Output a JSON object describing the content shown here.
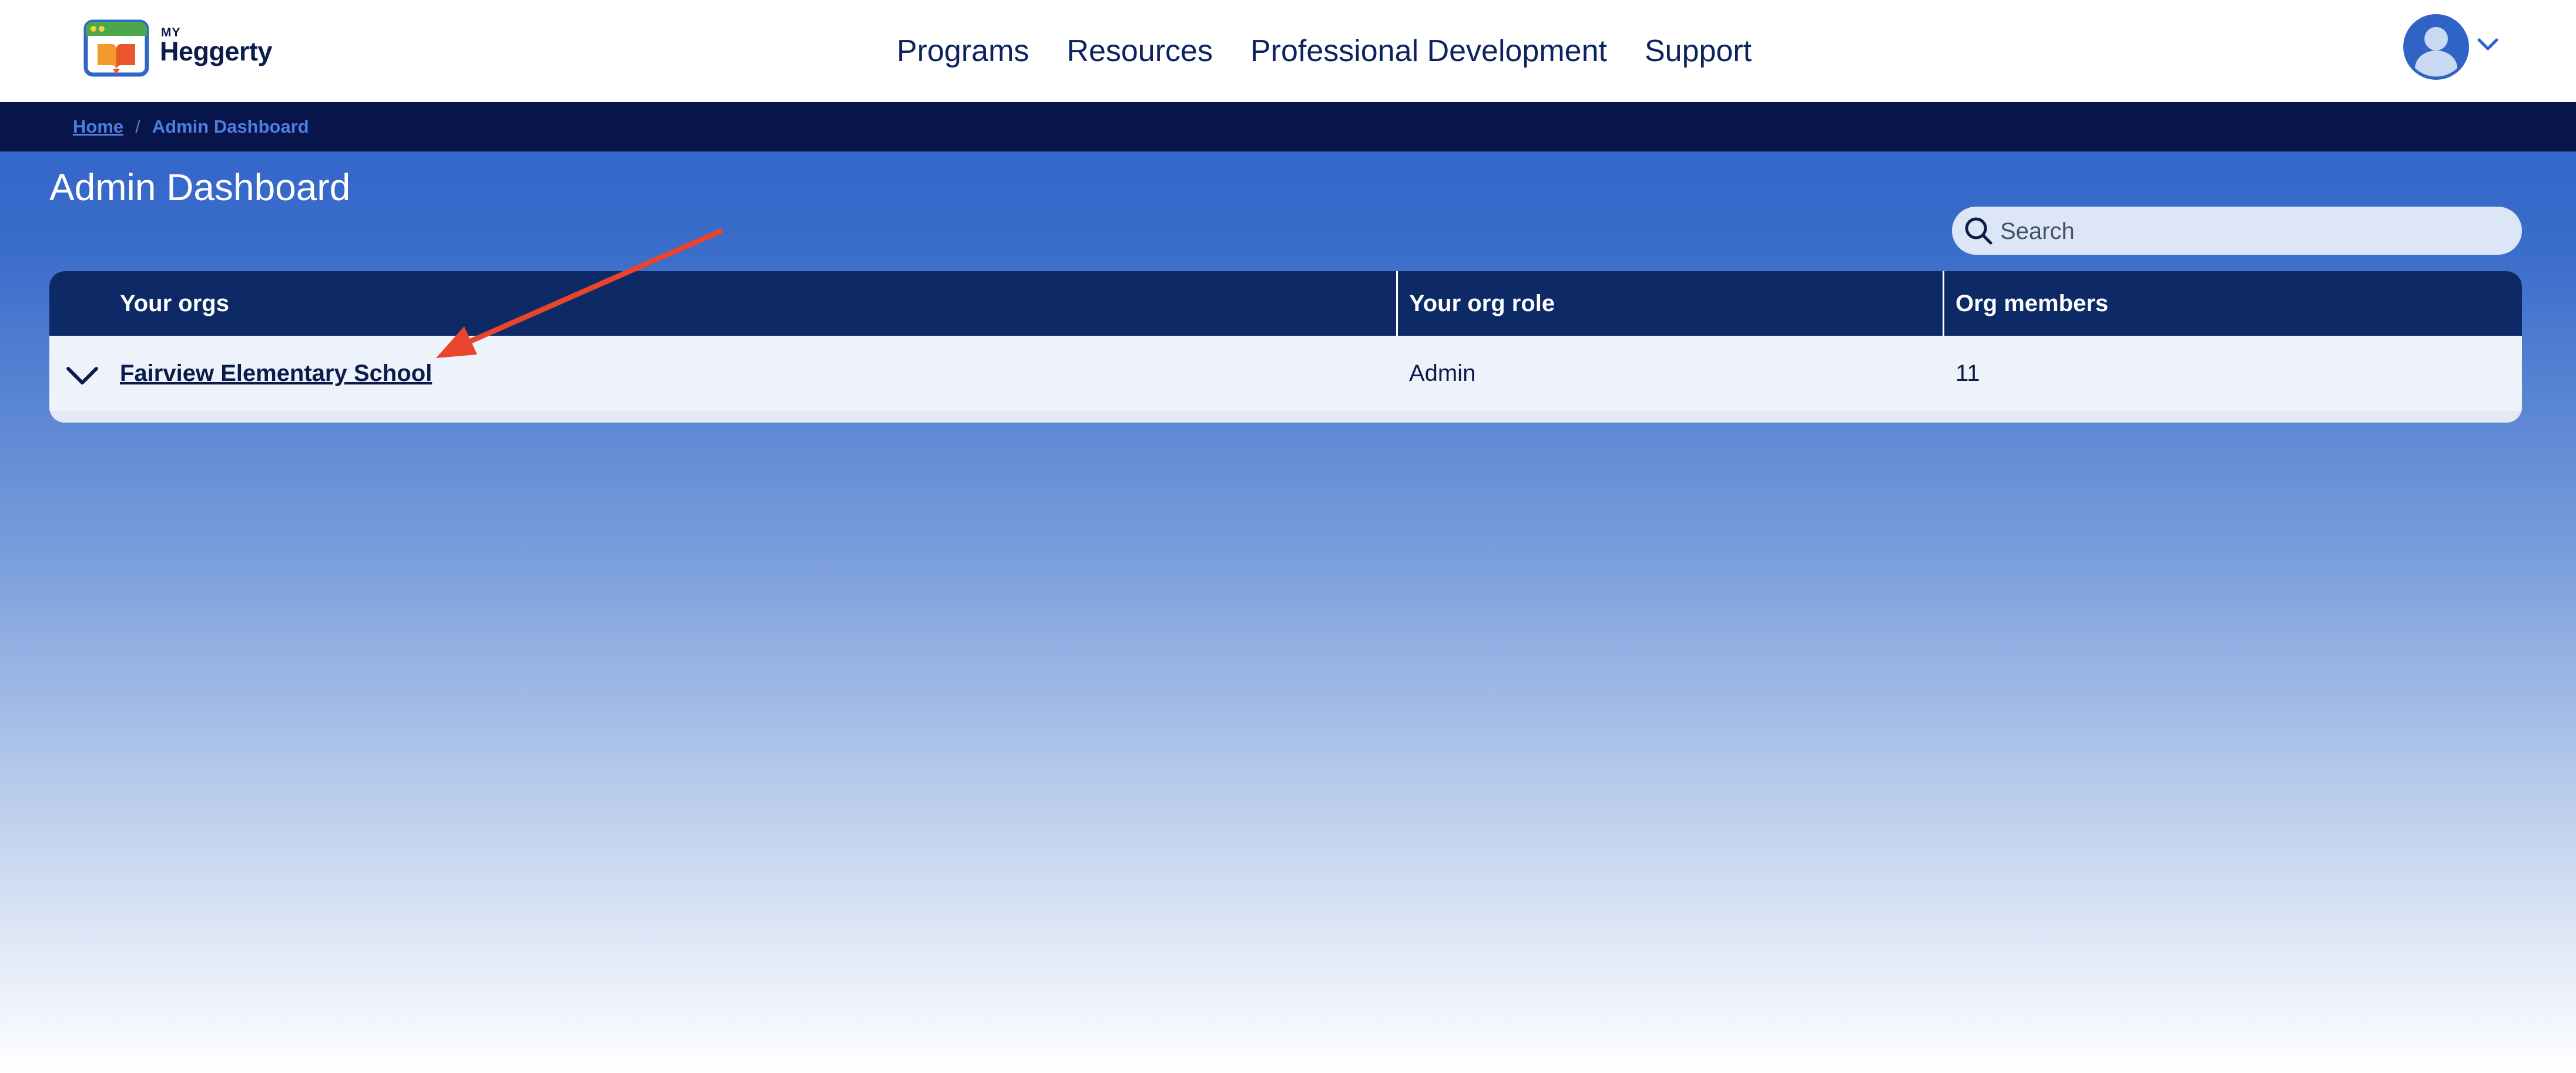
{
  "brand": {
    "small": "MY",
    "name": "Heggerty"
  },
  "nav": {
    "items": [
      "Programs",
      "Resources",
      "Professional Development",
      "Support"
    ]
  },
  "breadcrumb": {
    "home": "Home",
    "separator": "/",
    "current": "Admin Dashboard"
  },
  "page": {
    "title": "Admin Dashboard"
  },
  "search": {
    "placeholder": "Search",
    "value": ""
  },
  "table": {
    "columns": [
      "Your orgs",
      "Your org role",
      "Org members"
    ],
    "rows": [
      {
        "org": "Fairview Elementary School",
        "role": "Admin",
        "members": "11"
      }
    ]
  },
  "colors": {
    "brand_navy": "#0d1b4a",
    "header_blue": "#0e2a66",
    "page_blue": "#2b5fc6",
    "breadcrumb_bg": "#07154a",
    "annotation_red": "#e8452c"
  },
  "icons": {
    "avatar": "user-avatar-icon",
    "avatar_menu": "chevron-down-icon",
    "search": "search-icon",
    "row_expand": "chevron-down-icon",
    "annotation": "red-arrow"
  }
}
